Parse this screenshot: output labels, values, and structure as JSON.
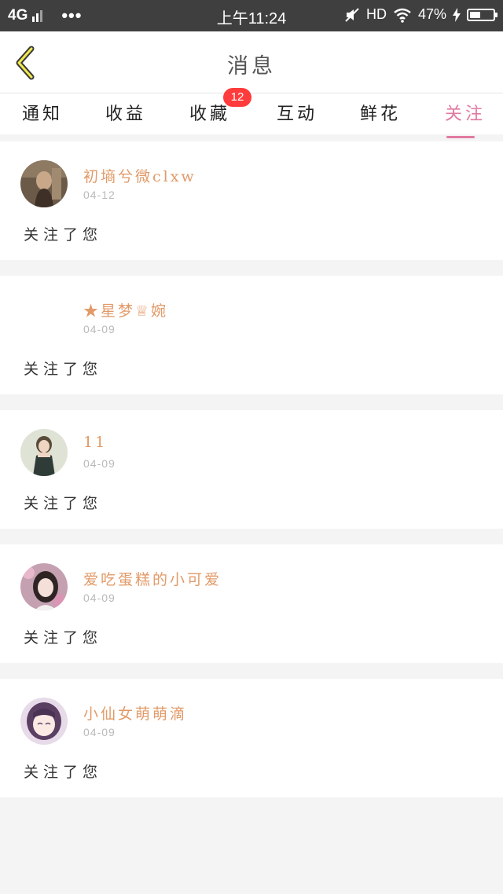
{
  "status_bar": {
    "network": "4G",
    "time": "上午11:24",
    "hd": "HD",
    "battery_text": "47%",
    "battery_level": 0.47
  },
  "nav": {
    "title": "消息",
    "back_icon": "chevron-left-icon"
  },
  "tabs": [
    {
      "label": "通知"
    },
    {
      "label": "收益"
    },
    {
      "label": "收藏",
      "badge": "12"
    },
    {
      "label": "互动"
    },
    {
      "label": "鲜花"
    },
    {
      "label": "关注",
      "active": true
    }
  ],
  "colors": {
    "accent": "#e07aa0",
    "username": "#e29a68",
    "badge": "#ff3b3b"
  },
  "messages": [
    {
      "username": "初墒兮微clxw",
      "date": "04-12",
      "text": "关注了您"
    },
    {
      "username": "★星梦♕婉",
      "date": "04-09",
      "text": "关注了您"
    },
    {
      "username": "11",
      "date": "04-09",
      "text": "关注了您"
    },
    {
      "username": "爱吃蛋糕的小可爱",
      "date": "04-09",
      "text": "关注了您"
    },
    {
      "username": "小仙女萌萌滴",
      "date": "04-09",
      "text": "关注了您"
    }
  ]
}
